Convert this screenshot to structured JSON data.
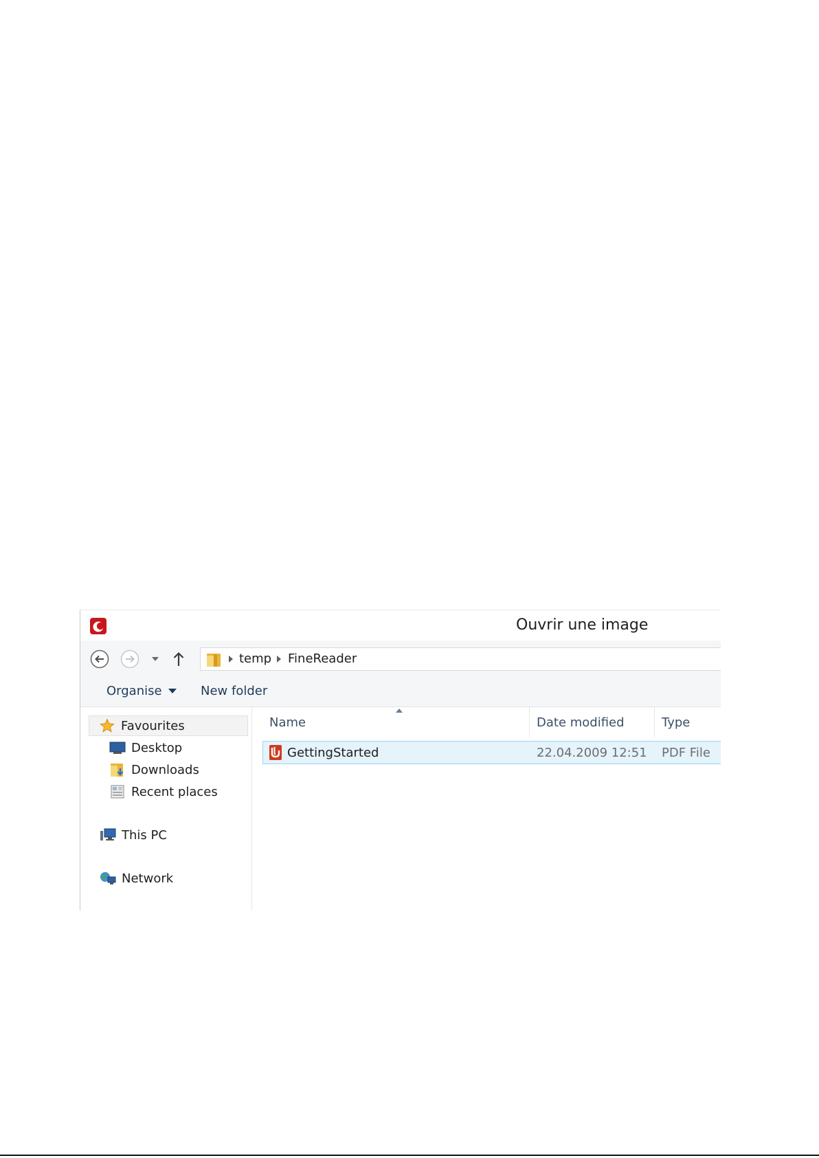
{
  "dialog": {
    "title": "Ouvrir une image",
    "app_logo": "abbyy-finereader-logo-icon"
  },
  "navigation": {
    "back_icon": "back-arrow-icon",
    "forward_icon": "forward-arrow-icon",
    "recent_icon": "chevron-down-icon",
    "up_icon": "up-arrow-icon"
  },
  "address": {
    "folder_icon": "folder-icon",
    "breadcrumbs": [
      "temp",
      "FineReader"
    ]
  },
  "toolbar": {
    "organise_label": "Organise",
    "new_folder_label": "New folder"
  },
  "sidebar": {
    "items": [
      {
        "label": "Favourites",
        "icon": "star-icon"
      },
      {
        "label": "Desktop",
        "icon": "desktop-icon"
      },
      {
        "label": "Downloads",
        "icon": "downloads-folder-icon"
      },
      {
        "label": "Recent places",
        "icon": "recent-places-icon"
      },
      {
        "label": "This PC",
        "icon": "computer-icon"
      },
      {
        "label": "Network",
        "icon": "network-icon"
      }
    ]
  },
  "file_list": {
    "columns": [
      "Name",
      "Date modified",
      "Type"
    ],
    "sort": {
      "column": "Name",
      "direction": "ascending"
    },
    "rows": [
      {
        "name": "GettingStarted",
        "date_modified": "22.04.2009 12:51",
        "type": "PDF File",
        "icon": "pdf-file-icon",
        "selected": true
      }
    ]
  },
  "colors": {
    "accent": "#1e3a5a",
    "selection_bg": "#e5f3fb",
    "selection_border": "#9fd3f0",
    "logo_red": "#c8171e"
  }
}
